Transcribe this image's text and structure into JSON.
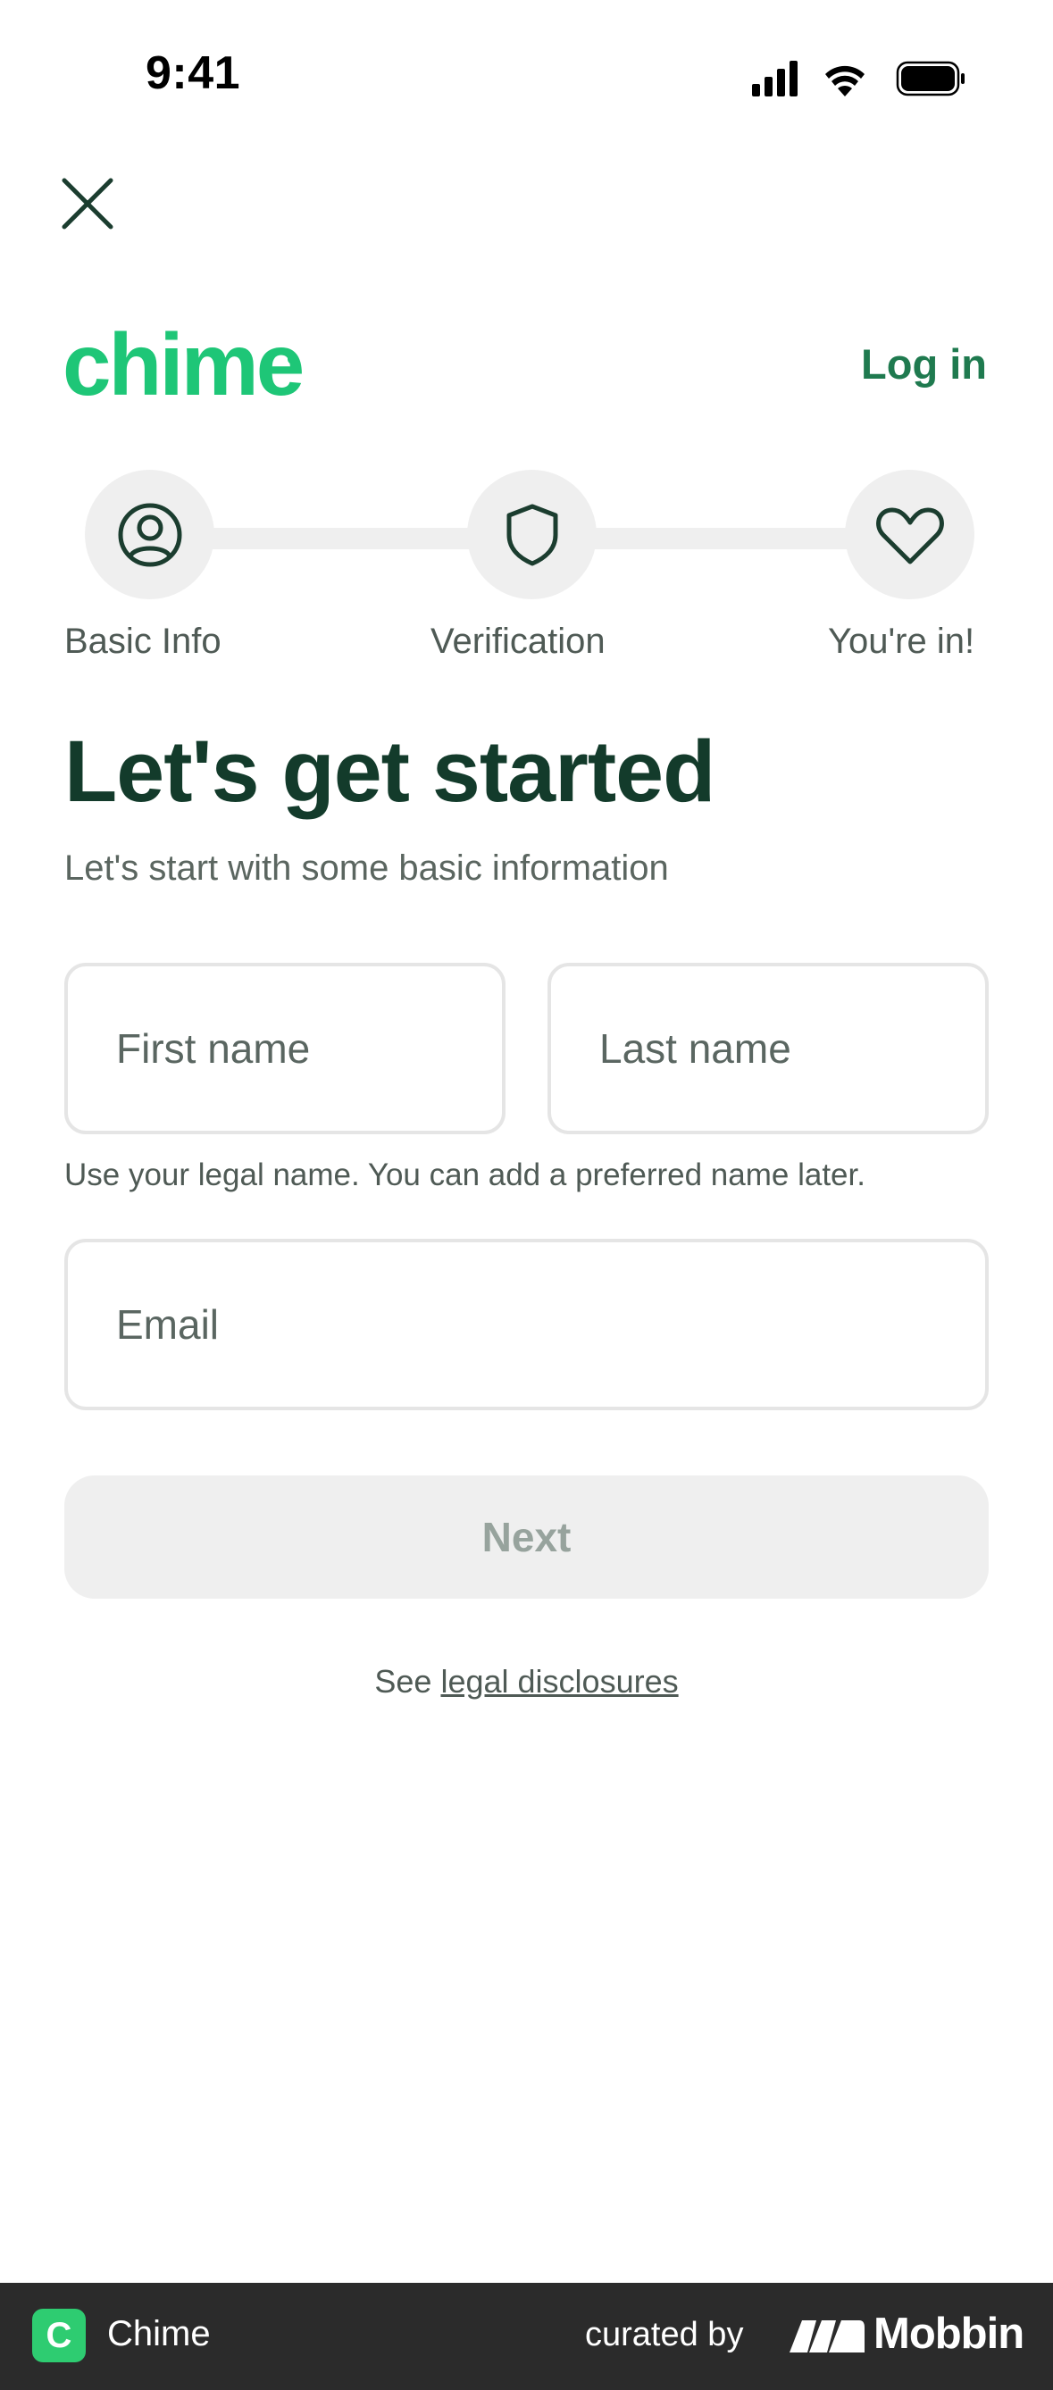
{
  "status_bar": {
    "time": "9:41"
  },
  "header": {
    "logo_text": "chime",
    "login_label": "Log in"
  },
  "stepper": {
    "steps": [
      {
        "label": "Basic Info",
        "icon": "user-circle-icon"
      },
      {
        "label": "Verification",
        "icon": "shield-icon"
      },
      {
        "label": "You're in!",
        "icon": "heart-icon"
      }
    ]
  },
  "form": {
    "title": "Let's get started",
    "subtitle": "Let's start with some basic information",
    "first_name": {
      "placeholder": "First name",
      "value": ""
    },
    "last_name": {
      "placeholder": "Last name",
      "value": ""
    },
    "name_hint": "Use your legal name. You can add a preferred name later.",
    "email": {
      "placeholder": "Email",
      "value": ""
    },
    "next_label": "Next"
  },
  "legal": {
    "prefix": "See",
    "link_text": "legal disclosures"
  },
  "footer": {
    "app_icon_letter": "C",
    "app_name": "Chime",
    "curated_by": "curated by",
    "brand": "Mobbin"
  },
  "colors": {
    "brand_green": "#1ec677",
    "link_green": "#1f7a4f",
    "dark_green": "#133b2b",
    "step_bg": "#efefef",
    "footer_bg": "#2b2b2b"
  }
}
